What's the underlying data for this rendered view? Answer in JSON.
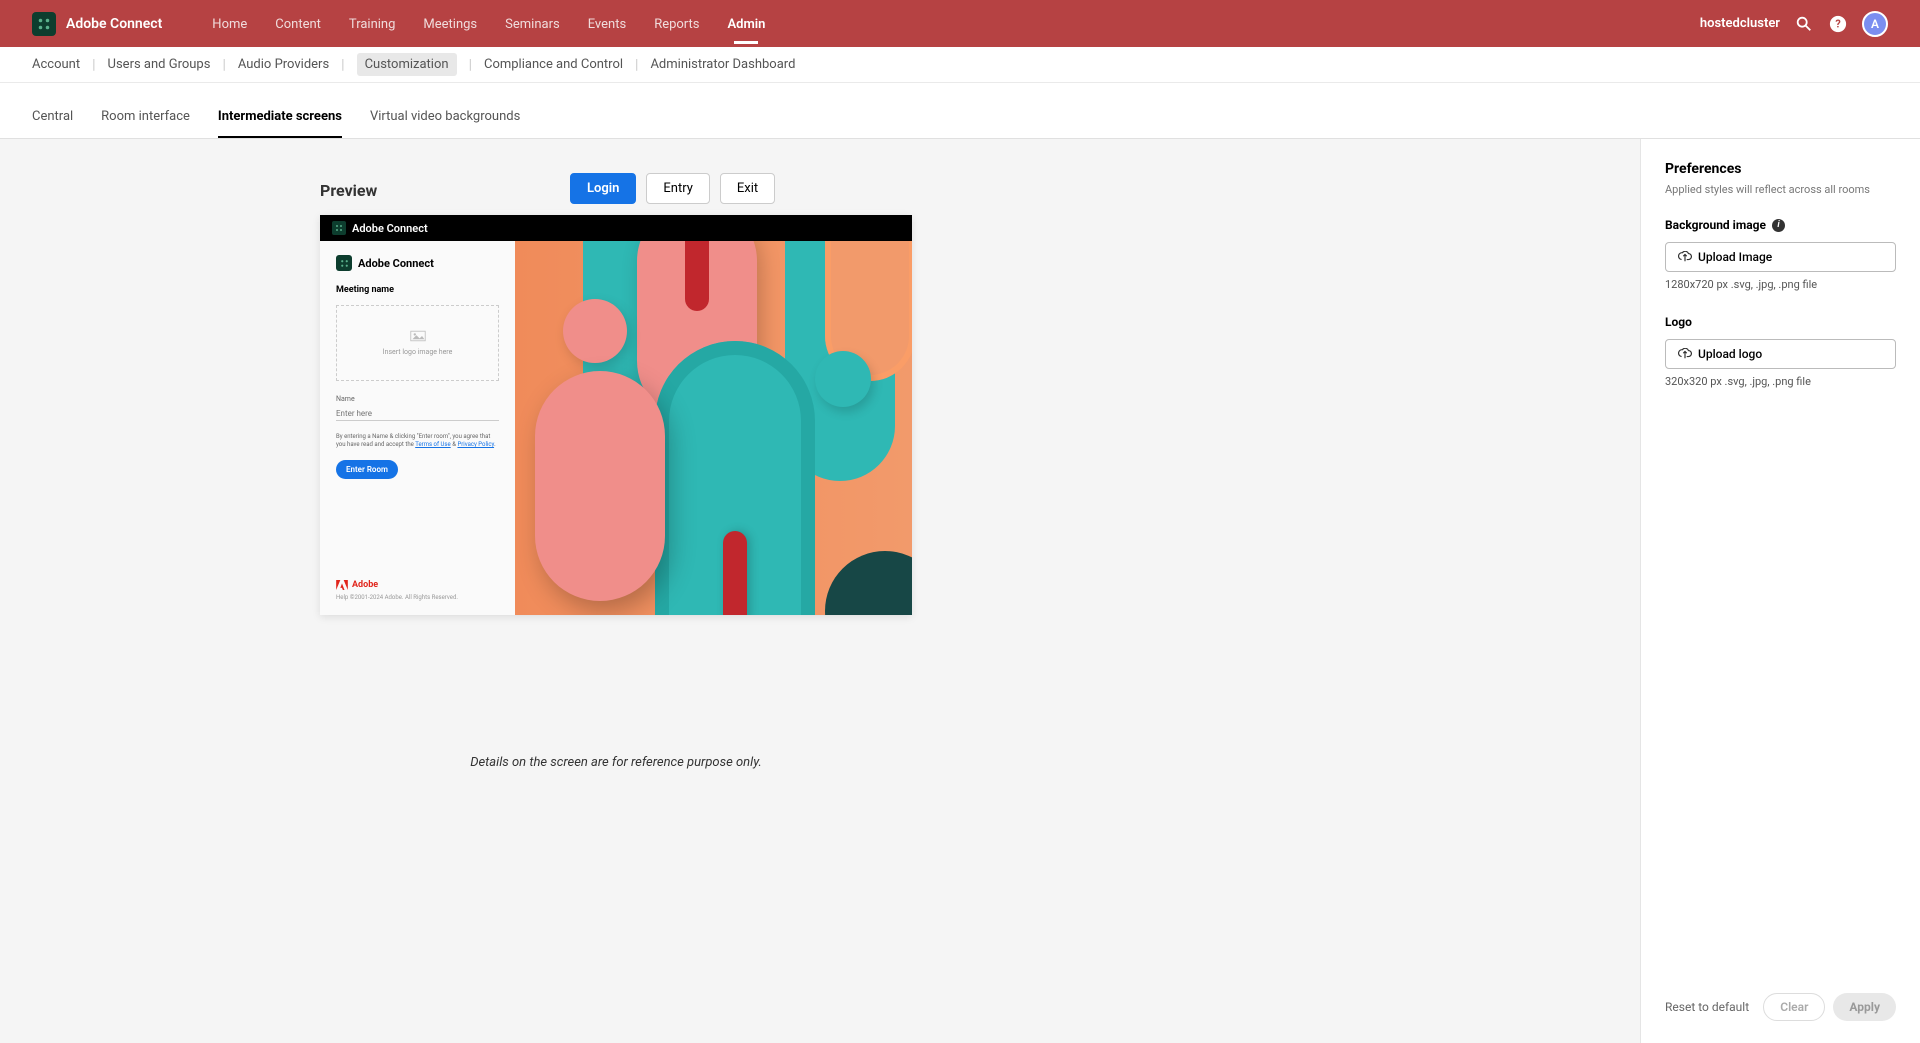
{
  "app": {
    "name": "Adobe Connect",
    "cluster": "hostedcluster",
    "avatar_initial": "A"
  },
  "topnav": {
    "home": "Home",
    "content": "Content",
    "training": "Training",
    "meetings": "Meetings",
    "seminars": "Seminars",
    "events": "Events",
    "reports": "Reports",
    "admin": "Admin"
  },
  "subnav": {
    "account": "Account",
    "users": "Users and Groups",
    "audio": "Audio Providers",
    "customization": "Customization",
    "compliance": "Compliance and Control",
    "dashboard": "Administrator Dashboard"
  },
  "tabs": {
    "central": "Central",
    "room": "Room interface",
    "intermediate": "Intermediate screens",
    "virtual": "Virtual video backgrounds"
  },
  "preview": {
    "title": "Preview",
    "login": "Login",
    "entry": "Entry",
    "exit": "Exit",
    "header_label": "Adobe Connect",
    "login_app": "Adobe Connect",
    "meeting_name": "Meeting name",
    "logo_placeholder": "Insert logo image here",
    "name_label": "Name",
    "name_placeholder": "Enter here",
    "legal_pre": "By entering a Name & clicking \"Enter room\", you agree that you have read and accept the ",
    "terms": "Terms of Use",
    "amp": " & ",
    "privacy": "Privacy Policy",
    "enter_room": "Enter Room",
    "adobe_brand": "Adobe",
    "copyright": "Help ©2001-2024 Adobe. All Rights Reserved."
  },
  "caption": "Details on the screen are for reference purpose only.",
  "sidebar": {
    "title": "Preferences",
    "subtitle": "Applied styles will reflect across all rooms",
    "bg_section": "Background image",
    "upload_image": "Upload Image",
    "bg_hint": "1280x720 px .svg, .jpg, .png file",
    "logo_section": "Logo",
    "upload_logo": "Upload logo",
    "logo_hint": "320x320 px .svg, .jpg, .png file",
    "reset": "Reset to default",
    "clear": "Clear",
    "apply": "Apply"
  }
}
